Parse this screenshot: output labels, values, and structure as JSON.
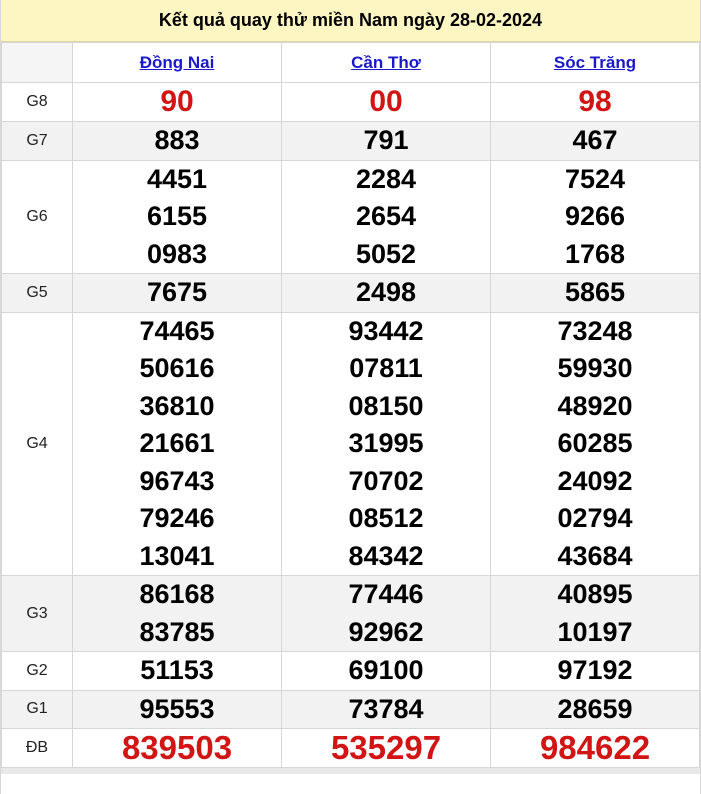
{
  "title": "Kết quả quay thử miền Nam ngày 28-02-2024",
  "provinces": [
    "Đồng Nai",
    "Cần Thơ",
    "Sóc Trăng"
  ],
  "colors": {
    "header_bg": "#fdf6c3",
    "link": "#1a1acb",
    "highlight_red": "#d11414",
    "alt_row": "#f2f2f2"
  },
  "rows": [
    {
      "label": "G8",
      "values": [
        [
          "90"
        ],
        [
          "00"
        ],
        [
          "98"
        ]
      ]
    },
    {
      "label": "G7",
      "values": [
        [
          "883"
        ],
        [
          "791"
        ],
        [
          "467"
        ]
      ]
    },
    {
      "label": "G6",
      "values": [
        [
          "4451",
          "6155",
          "0983"
        ],
        [
          "2284",
          "2654",
          "5052"
        ],
        [
          "7524",
          "9266",
          "1768"
        ]
      ]
    },
    {
      "label": "G5",
      "values": [
        [
          "7675"
        ],
        [
          "2498"
        ],
        [
          "5865"
        ]
      ]
    },
    {
      "label": "G4",
      "values": [
        [
          "74465",
          "50616",
          "36810",
          "21661",
          "96743",
          "79246",
          "13041"
        ],
        [
          "93442",
          "07811",
          "08150",
          "31995",
          "70702",
          "08512",
          "84342"
        ],
        [
          "73248",
          "59930",
          "48920",
          "60285",
          "24092",
          "02794",
          "43684"
        ]
      ]
    },
    {
      "label": "G3",
      "values": [
        [
          "86168",
          "83785"
        ],
        [
          "77446",
          "92962"
        ],
        [
          "40895",
          "10197"
        ]
      ]
    },
    {
      "label": "G2",
      "values": [
        [
          "51153"
        ],
        [
          "69100"
        ],
        [
          "97192"
        ]
      ]
    },
    {
      "label": "G1",
      "values": [
        [
          "95553"
        ],
        [
          "73784"
        ],
        [
          "28659"
        ]
      ]
    },
    {
      "label": "ĐB",
      "values": [
        [
          "839503"
        ],
        [
          "535297"
        ],
        [
          "984622"
        ]
      ]
    }
  ]
}
